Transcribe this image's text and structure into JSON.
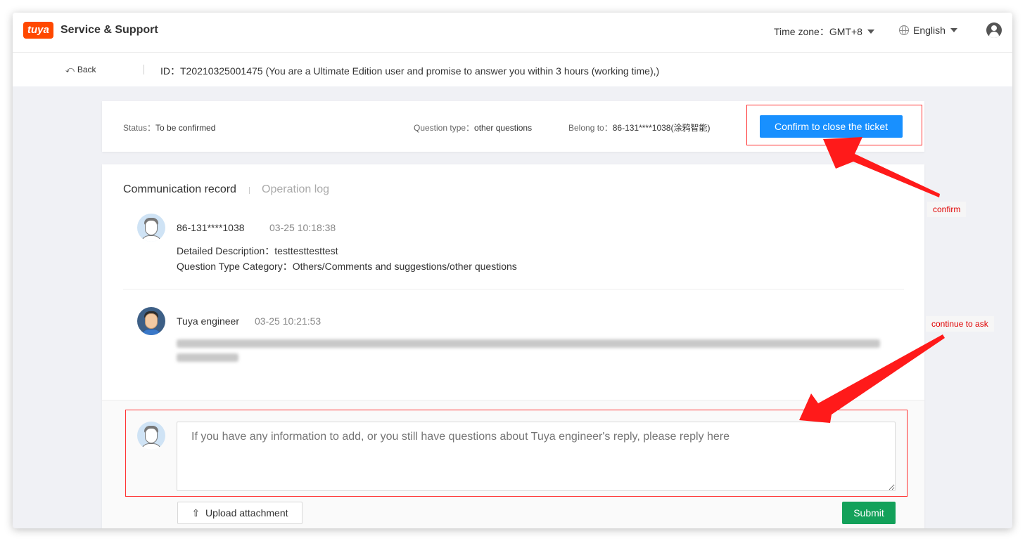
{
  "header": {
    "logo_text": "tuya",
    "brand_title": "Service & Support",
    "timezone_label": "Time zone：",
    "timezone_value": "GMT+8",
    "language": "English"
  },
  "subbar": {
    "back_label": "Back",
    "ticket_id_label": "ID：",
    "ticket_id": "T20210325001475",
    "ticket_note": "(You are a Ultimate Edition user and promise to answer you within 3 hours (working time),)"
  },
  "status_card": {
    "status_label": "Status：",
    "status_value": "To be confirmed",
    "question_type_label": "Question type：",
    "question_type_value": "other questions",
    "belong_label": "Belong to：",
    "belong_value": "86-131****1038(涂鸦智能)",
    "confirm_button": "Confirm to close the ticket"
  },
  "communication": {
    "tabs": [
      {
        "label": "Communication record",
        "active": true
      },
      {
        "label": "Operation log",
        "active": false
      }
    ],
    "messages": [
      {
        "author": "86-131****1038",
        "time": "03-25 10:18:38",
        "lines": [
          "Detailed Description：testtesttesttest",
          "Question Type Category：Others/Comments and suggestions/other questions"
        ]
      },
      {
        "author": "Tuya engineer",
        "time": "03-25 10:21:53"
      }
    ]
  },
  "reply": {
    "placeholder": "If you have any information to add, or you still have questions about Tuya engineer's reply, please reply here",
    "upload_label": "Upload attachment",
    "submit_label": "Submit"
  },
  "annotations": {
    "confirm": "confirm",
    "continue": "continue to ask"
  },
  "colors": {
    "primary_blue": "#1890ff",
    "submit_green": "#13a15a",
    "annotation_red": "#ff3333",
    "brand_orange": "#ff4800"
  }
}
